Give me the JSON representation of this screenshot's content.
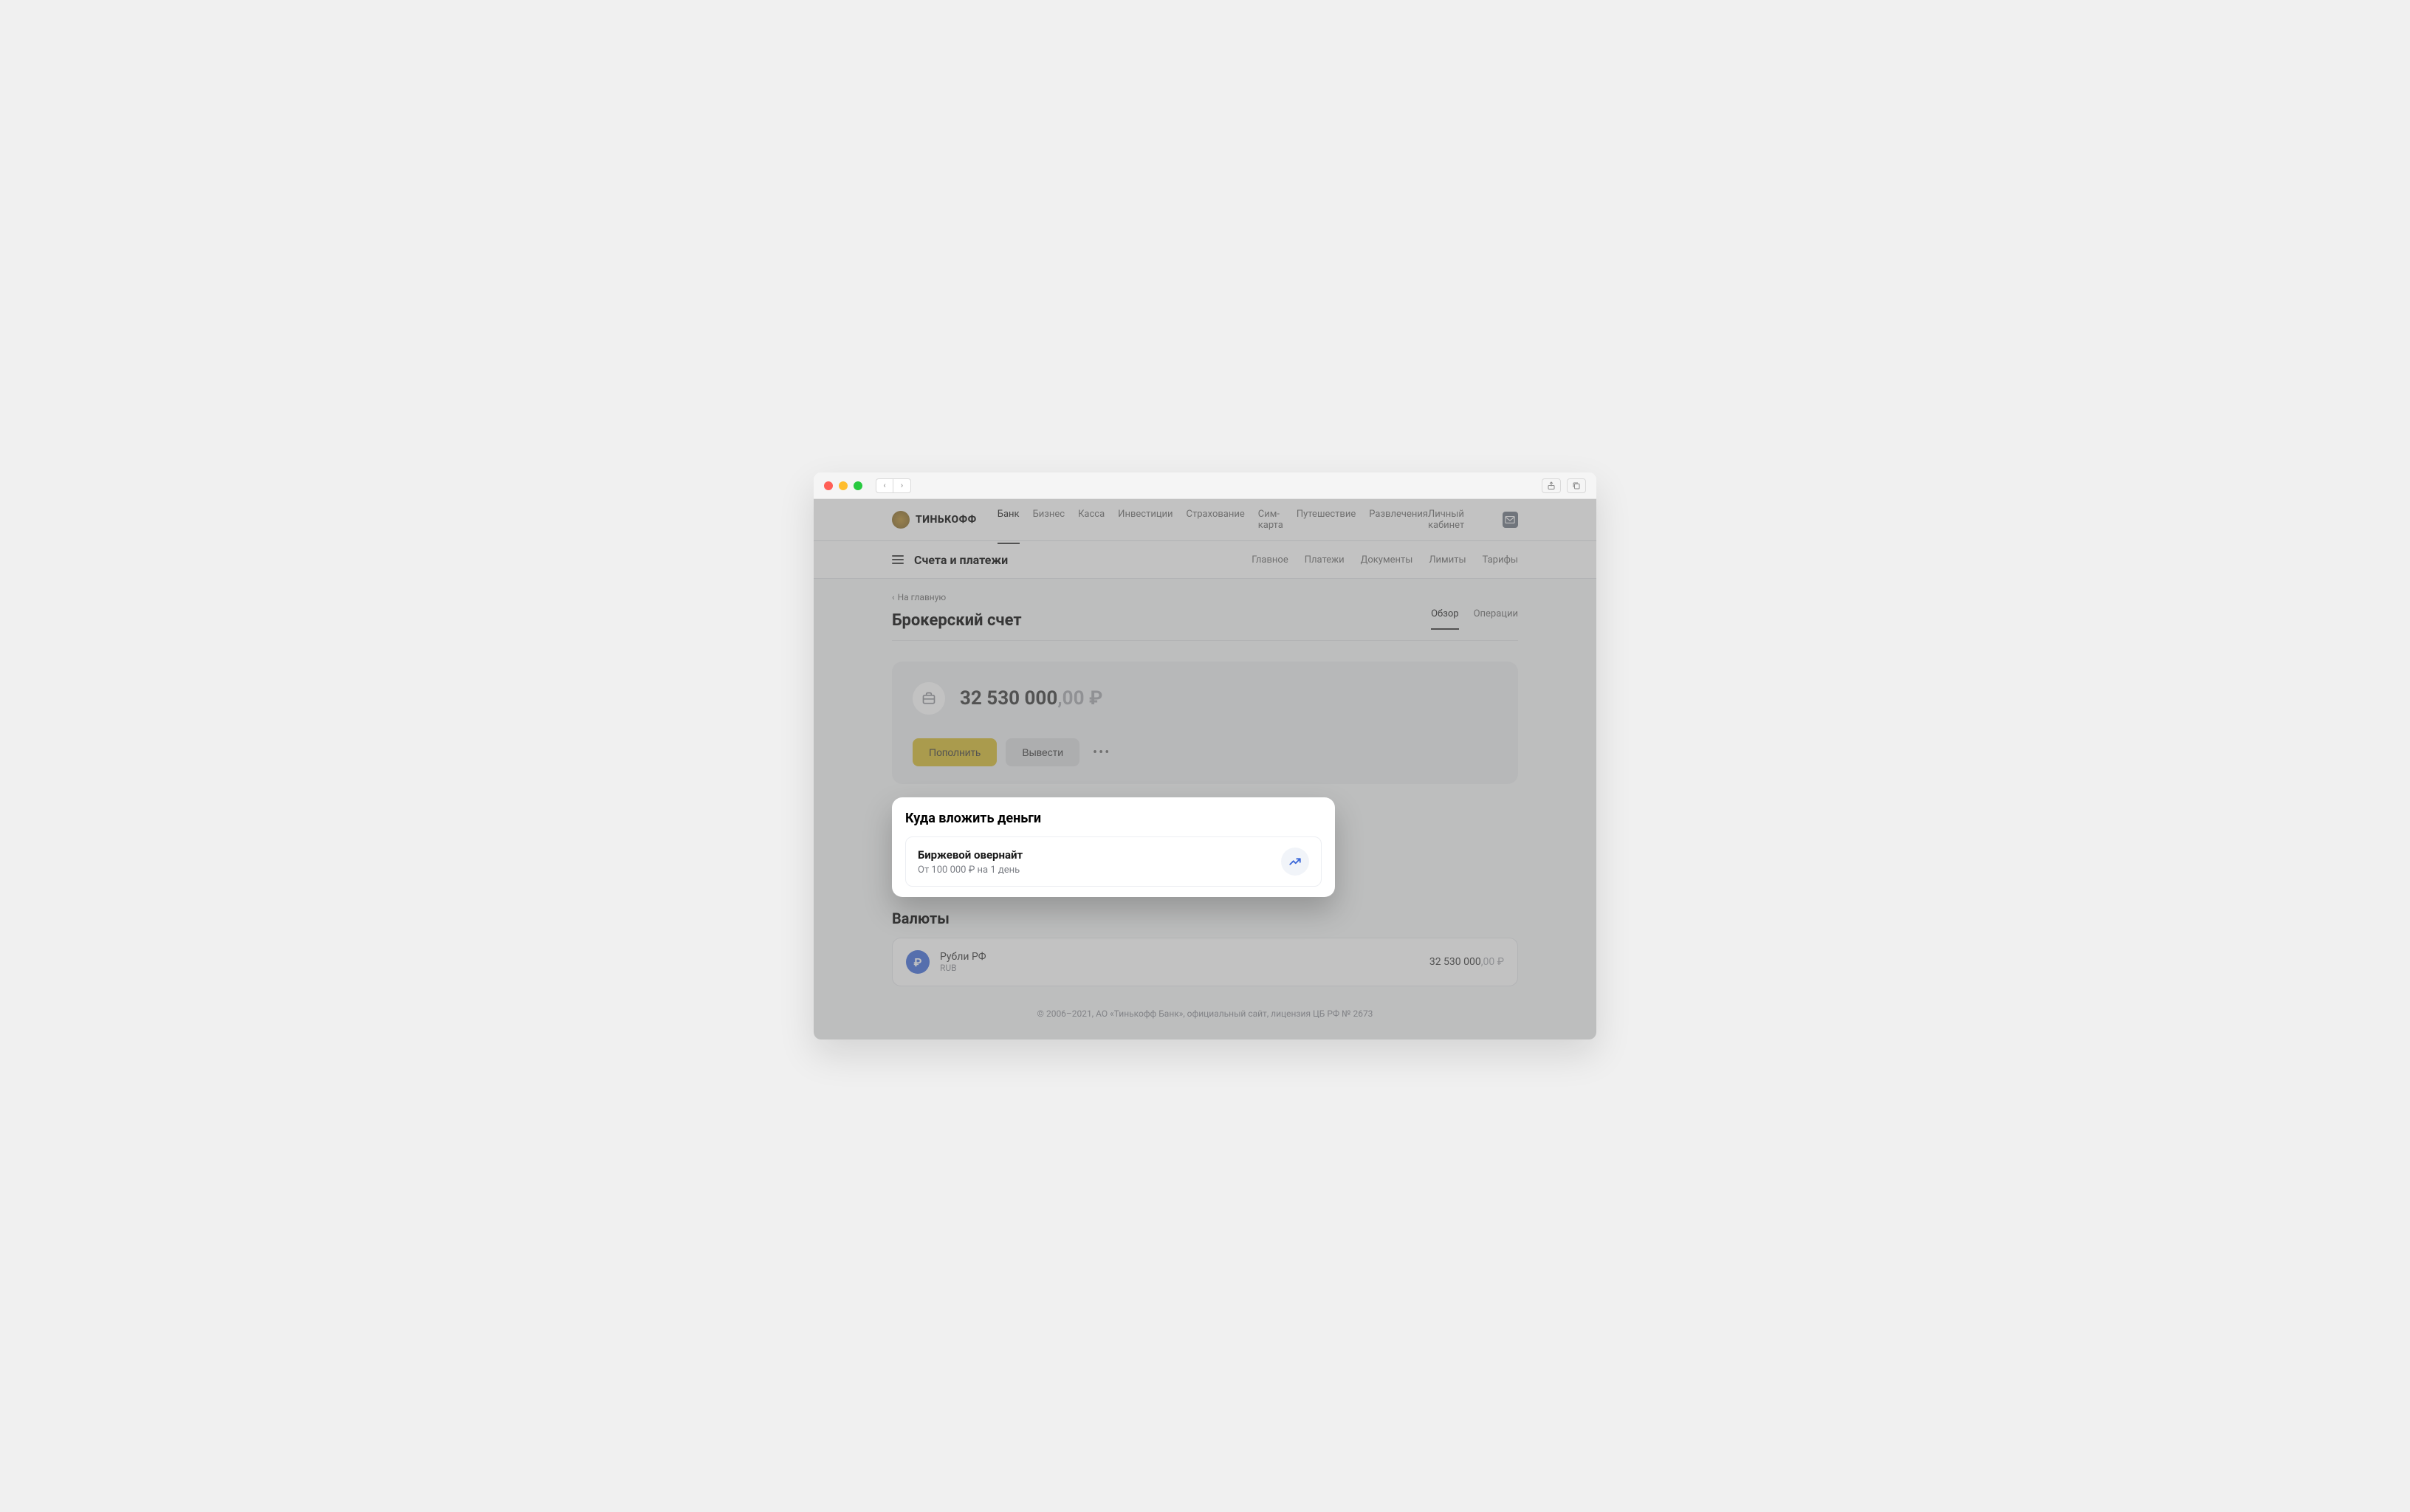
{
  "logo_text": "ТИНЬКОФФ",
  "nav": [
    "Банк",
    "Бизнес",
    "Касса",
    "Инвестиции",
    "Страхование",
    "Сим-карта",
    "Путешествие",
    "Развлечения"
  ],
  "nav_active_index": 0,
  "cabinet": "Личный кабинет",
  "subnav": {
    "title": "Счета и платежи",
    "links": [
      "Главное",
      "Платежи",
      "Документы",
      "Лимиты",
      "Тарифы"
    ]
  },
  "breadcrumb": "На главную",
  "page_title": "Брокерский счет",
  "tabs": [
    "Обзор",
    "Операции"
  ],
  "tabs_active_index": 0,
  "balance": {
    "main": "32 530 000",
    "cents": ",00",
    "currency": "₽"
  },
  "actions": {
    "deposit": "Пополнить",
    "withdraw": "Вывести"
  },
  "invest": {
    "title": "Куда вложить деньги",
    "item_title": "Биржевой овернайт",
    "item_sub": "От 100 000 ₽ на 1 день"
  },
  "currencies_title": "Валюты",
  "currency": {
    "name": "Рубли РФ",
    "code": "RUB",
    "symbol": "₽",
    "amount_main": "32 530 000",
    "amount_cents": ",00",
    "amount_currency": "₽"
  },
  "footer": "© 2006–2021, АО «Тинькофф Банк», официальный сайт, лицензия ЦБ РФ № 2673"
}
